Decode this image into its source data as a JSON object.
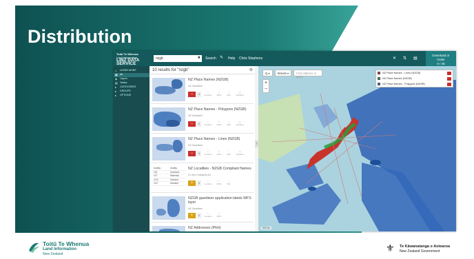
{
  "slide": {
    "title": "Distribution"
  },
  "app": {
    "logo_line1": "Toitū Te Whenua",
    "logo_line2": "Land Information",
    "logo_line3": "New Zealand",
    "logo_name": "LINZ DATA SERVICE",
    "search_value": "nzgb",
    "search_button": "Search",
    "help_label": "Help",
    "user_label": "Chris Stephens",
    "download_label": "Download or Order",
    "download_sub": "0 / 45"
  },
  "sidebar": {
    "items": [
      {
        "label": "LEARN MORE"
      },
      {
        "label": "All"
      },
      {
        "label": "Layers"
      },
      {
        "label": "Tables"
      },
      {
        "label": "CATEGORIES"
      },
      {
        "label": "GROUPS"
      },
      {
        "label": "OPTIONS"
      }
    ]
  },
  "results": {
    "heading": "10 results for \"nzgb\"",
    "cards": [
      {
        "title": "NZ Place Names (NZGB)",
        "sub": "NZ Gazetteer",
        "action": "−",
        "count": "1"
      },
      {
        "title": "NZ Place Names - Polygons (NZGB)",
        "sub": "NZ Gazetteer",
        "action": "−",
        "count": "1"
      },
      {
        "title": "NZ Place Names - Lines (NZGB)",
        "sub": "NZ Gazetteer",
        "action": "−",
        "count": "1"
      },
      {
        "title": "NZ Localities - NZGB Compliant Names",
        "sub": "Co and Categorty AU",
        "action": "+",
        "count": "1"
      },
      {
        "title": "NZGB gazetteer application labels WFS layer",
        "sub": "NZ Gazetteer",
        "action": "+",
        "count": "1"
      },
      {
        "title": "NZ Addresses (Pilot)",
        "sub": "",
        "action": "",
        "count": ""
      }
    ],
    "meta_labels": [
      "Location",
      "WFS",
      "Wkt",
      "Updated"
    ],
    "mini_table": {
      "header": [
        "locality...",
        "locality..."
      ],
      "rows": [
        [
          "100",
          "Auckland"
        ],
        [
          "107",
          "Waimata..."
        ],
        [
          "1110",
          "Aickland"
        ],
        [
          "1117",
          "Aickland"
        ]
      ]
    }
  },
  "map": {
    "tool_search": "Q",
    "tool_streets": "Streets",
    "address_placeholder": "Find address or place",
    "zoom_in": "+",
    "zoom_out": "−",
    "scale": "500 km",
    "legend": [
      {
        "label": "NZ Place Names - Lines (NZGB)",
        "color": "#c9302c"
      },
      {
        "label": "NZ Place Names (NZGB)",
        "color": "#2a9d3a"
      },
      {
        "label": "NZ Place Names - Polygons (NZGB)",
        "color": "#3b6fb6"
      }
    ]
  },
  "footer": {
    "left_line1": "Toitū Te Whenua",
    "left_line2": "Land Information",
    "left_line3": "New Zealand",
    "right_line1": "Te Kāwanatanga o Aotearoa",
    "right_line2": "New Zealand Government"
  },
  "colors": {
    "brand": "#145a5c",
    "accent": "#1a7a73",
    "danger": "#c9302c",
    "warn": "#d9a216",
    "water": "#aad3df"
  }
}
